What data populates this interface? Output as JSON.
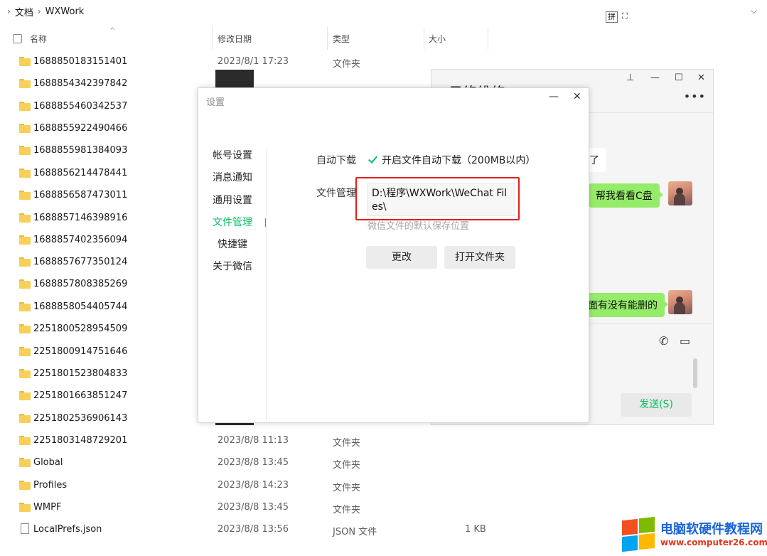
{
  "explorer": {
    "breadcrumb": [
      "文档",
      "WXWork"
    ],
    "ime": {
      "mode": "拼",
      "icon": "fullscreen-icon"
    },
    "columns": {
      "name": "名称",
      "date": "修改日期",
      "type": "类型",
      "size": "大小"
    },
    "rows": [
      {
        "name": "1688850183151401",
        "date": "2023/8/1 17:23",
        "type": "文件夹",
        "size": ""
      },
      {
        "name": "1688854342397842",
        "date": "",
        "type": "",
        "size": ""
      },
      {
        "name": "1688855460342537",
        "date": "",
        "type": "",
        "size": ""
      },
      {
        "name": "1688855922490466",
        "date": "",
        "type": "",
        "size": ""
      },
      {
        "name": "1688855981384093",
        "date": "",
        "type": "",
        "size": ""
      },
      {
        "name": "1688856214478441",
        "date": "",
        "type": "",
        "size": ""
      },
      {
        "name": "1688856587473011",
        "date": "",
        "type": "",
        "size": ""
      },
      {
        "name": "1688857146398916",
        "date": "",
        "type": "",
        "size": ""
      },
      {
        "name": "1688857402356094",
        "date": "",
        "type": "",
        "size": ""
      },
      {
        "name": "1688857677350124",
        "date": "",
        "type": "",
        "size": ""
      },
      {
        "name": "1688857808385269",
        "date": "",
        "type": "",
        "size": ""
      },
      {
        "name": "1688858054405744",
        "date": "",
        "type": "",
        "size": ""
      },
      {
        "name": "2251800528954509",
        "date": "",
        "type": "",
        "size": ""
      },
      {
        "name": "2251800914751646",
        "date": "",
        "type": "",
        "size": ""
      },
      {
        "name": "2251801523804833",
        "date": "",
        "type": "",
        "size": ""
      },
      {
        "name": "2251801663851247",
        "date": "",
        "type": "",
        "size": ""
      },
      {
        "name": "2251802536906143",
        "date": "",
        "type": "",
        "size": ""
      },
      {
        "name": "2251803148729201",
        "date": "2023/8/8 11:13",
        "type": "文件夹",
        "size": ""
      },
      {
        "name": "Global",
        "date": "2023/8/8 13:45",
        "type": "文件夹",
        "size": ""
      },
      {
        "name": "Profiles",
        "date": "2023/8/8 14:23",
        "type": "文件夹",
        "size": ""
      },
      {
        "name": "WMPF",
        "date": "2023/8/8 13:45",
        "type": "文件夹",
        "size": ""
      },
      {
        "name": "LocalPrefs.json",
        "date": "2023/8/8 13:56",
        "type": "JSON 文件",
        "size": "1 KB"
      }
    ]
  },
  "chat": {
    "title": "只络维修",
    "messages": [
      {
        "side": "left",
        "text": "了"
      },
      {
        "side": "right",
        "text": "帮我看看C盘"
      },
      {
        "side": "right",
        "text": "面有没有能删的"
      }
    ],
    "send_label": "发送(S)"
  },
  "settings": {
    "title": "设置",
    "nav": [
      "帐号设置",
      "消息通知",
      "通用设置",
      "文件管理",
      "快捷键",
      "关于微信"
    ],
    "active_nav": "文件管理",
    "auto_download_label": "自动下载",
    "auto_download_checkbox": "开启文件自动下载（200MB以内）",
    "auto_download_checked": true,
    "file_manage_label": "文件管理",
    "path": "D:\\程序\\WXWork\\WeChat Files\\",
    "path_hint": "微信文件的默认保存位置",
    "change_button": "更改",
    "open_folder_button": "打开文件夹"
  },
  "watermark": {
    "line1": "电脑软硬件教程网",
    "line2": "www.computer26.com"
  }
}
